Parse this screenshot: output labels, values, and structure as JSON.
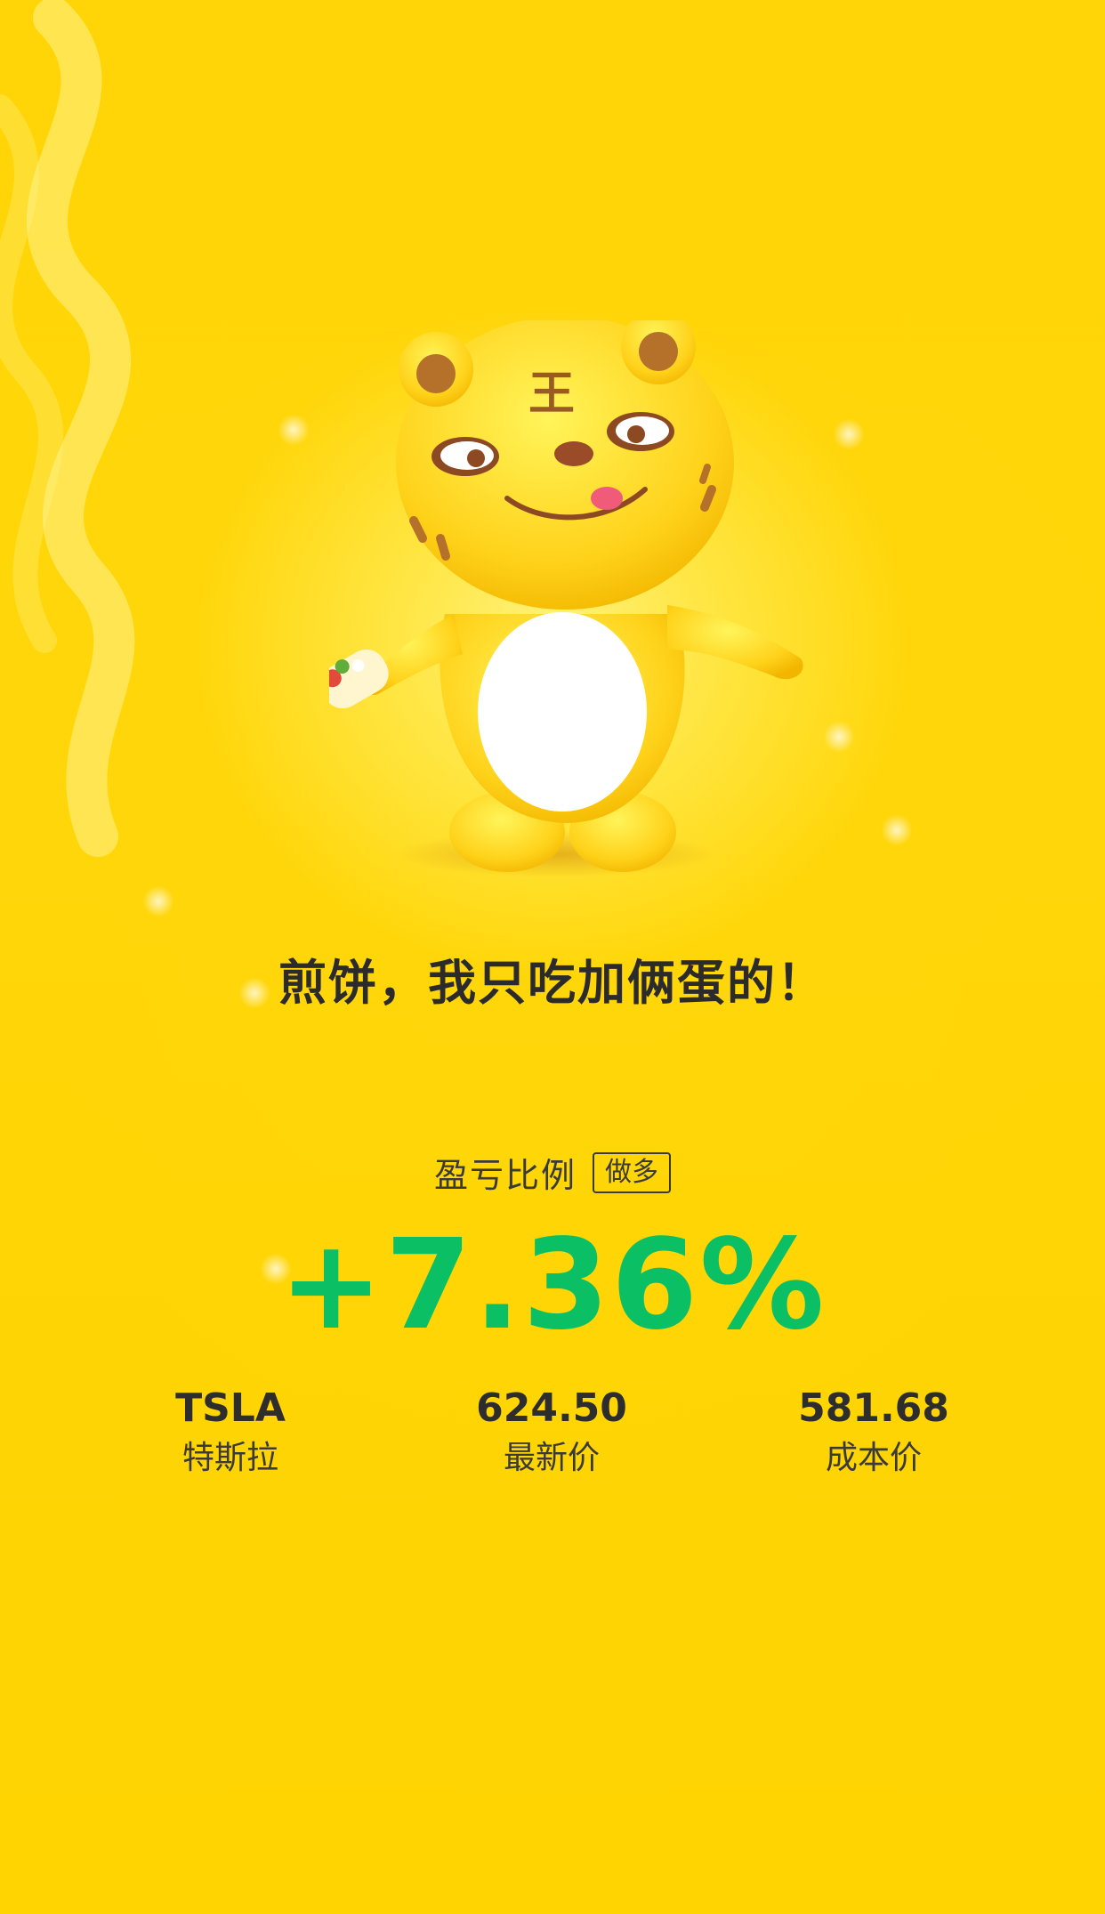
{
  "tagline": "煎饼，我只吃加俩蛋的！",
  "mascot": {
    "icon": "tiger-mascot-holding-pancake-icon",
    "forehead_mark": "王"
  },
  "pnl": {
    "label": "盈亏比例",
    "direction": "做多",
    "value": "+7.36%",
    "color": "#0bbf65"
  },
  "stats": [
    {
      "value": "TSLA",
      "label": "特斯拉"
    },
    {
      "value": "624.50",
      "label": "最新价"
    },
    {
      "value": "581.68",
      "label": "成本价"
    }
  ],
  "colors": {
    "background": "#ffd60a",
    "text": "#2d2d2d",
    "profit": "#0bbf65"
  }
}
